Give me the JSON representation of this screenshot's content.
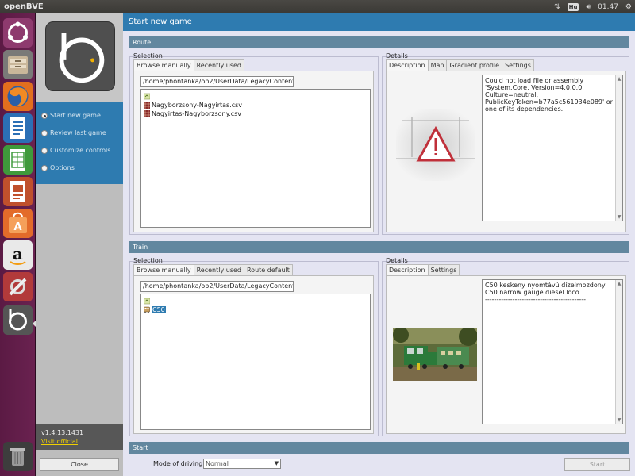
{
  "topbar": {
    "app_title": "openBVE",
    "keyboard_layout": "Hu",
    "clock": "01.47"
  },
  "launcher": {
    "items": [
      "ubuntu-icon",
      "files-icon",
      "firefox-icon",
      "writer-icon",
      "calc-icon",
      "impress-icon",
      "software-center-icon",
      "amazon-icon",
      "settings-icon",
      "openbve-icon",
      "trash-icon"
    ]
  },
  "left": {
    "menu": [
      {
        "label": "Start new game",
        "selected": true
      },
      {
        "label": "Review last game",
        "selected": false
      },
      {
        "label": "Customize controls",
        "selected": false
      },
      {
        "label": "Options",
        "selected": false
      }
    ],
    "version": "v1.4.13.1431",
    "visit_link": "Visit official",
    "close_label": "Close"
  },
  "main": {
    "header": "Start new game",
    "route": {
      "section": "Route",
      "selection_label": "Selection",
      "details_label": "Details",
      "tabs": [
        "Browse manually",
        "Recently used"
      ],
      "detail_tabs": [
        "Description",
        "Map",
        "Gradient profile",
        "Settings"
      ],
      "path": "/home/phontanka/ob2/UserData/LegacyContent/",
      "files": [
        "..",
        "Nagyborzsony-Nagyirtas.csv",
        "Nagyirtas-Nagyborzsony.csv"
      ],
      "description": "Could not load file or assembly 'System.Core, Version=4.0.0.0, Culture=neutral, PublicKeyToken=b77a5c561934e089' or one of its dependencies."
    },
    "train": {
      "section": "Train",
      "selection_label": "Selection",
      "details_label": "Details",
      "tabs": [
        "Browse manually",
        "Recently used",
        "Route default"
      ],
      "detail_tabs": [
        "Description",
        "Settings"
      ],
      "path": "/home/phontanka/ob2/UserData/LegacyContent/",
      "files": [
        "",
        "C50"
      ],
      "description_line1": "C50 keskeny nyomtávú dízelmozdony",
      "description_line2": "C50 narrow gauge diesel loco",
      "description_line3": "--------------------------------------------"
    },
    "start": {
      "section": "Start",
      "mode_label": "Mode of driving:",
      "mode_value": "Normal",
      "start_label": "Start"
    }
  }
}
